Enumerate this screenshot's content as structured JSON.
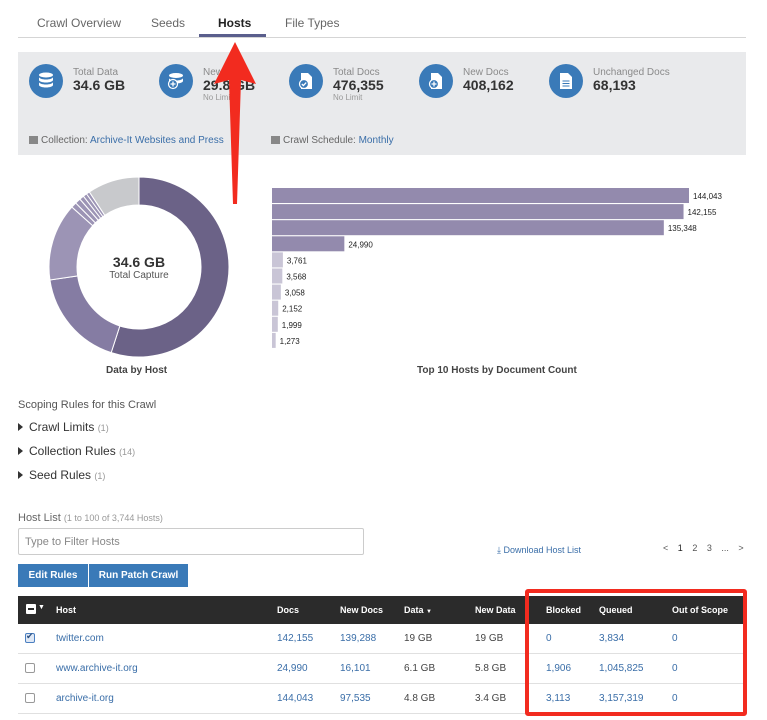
{
  "tabs": [
    "Crawl Overview",
    "Seeds",
    "Hosts",
    "File Types"
  ],
  "active_tab": "Hosts",
  "stats": {
    "total_data": {
      "label": "Total Data",
      "value": "34.6 GB"
    },
    "new_data": {
      "label": "New Data",
      "value": "29.8 GB",
      "sub": "No Limit"
    },
    "total_docs": {
      "label": "Total Docs",
      "value": "476,355",
      "sub": "No Limit"
    },
    "new_docs": {
      "label": "New Docs",
      "value": "408,162"
    },
    "unchanged_docs": {
      "label": "Unchanged Docs",
      "value": "68,193"
    }
  },
  "meta": {
    "collection_label": "Collection:",
    "collection_value": "Archive-It Websites and Press",
    "schedule_label": "Crawl Schedule:",
    "schedule_value": "Monthly"
  },
  "donut": {
    "value": "34.6 GB",
    "caption": "Total Capture",
    "title": "Data by Host",
    "colors": [
      "#6b6287",
      "#857ca3",
      "#9c94b5",
      "#c8c9cc"
    ],
    "slices": [
      0.55,
      0.177,
      0.139,
      0.01,
      0.01,
      0.008,
      0.007,
      0.006,
      0.093
    ]
  },
  "chart_data": {
    "type": "bar",
    "orientation": "horizontal",
    "title": "Top 10 Hosts by Document Count",
    "values": [
      144043,
      142155,
      135348,
      24990,
      3761,
      3568,
      3058,
      2152,
      1999,
      1273
    ],
    "labels": [
      "144,043",
      "142,155",
      "135,348",
      "24,990",
      "3,761",
      "3,568",
      "3,058",
      "2,152",
      "1,999",
      "1,273"
    ],
    "colors": {
      "bar": "#938aad",
      "bar_light": "#c9c5d6"
    }
  },
  "scoping": {
    "title": "Scoping Rules for this Crawl",
    "rules": [
      {
        "label": "Crawl Limits",
        "count": "(1)"
      },
      {
        "label": "Collection Rules",
        "count": "(14)"
      },
      {
        "label": "Seed Rules",
        "count": "(1)"
      }
    ]
  },
  "hostlist": {
    "title": "Host List",
    "subtitle": "(1 to 100 of 3,744 Hosts)",
    "filter_placeholder": "Type to Filter Hosts",
    "download": "Download Host List",
    "pages": [
      "1",
      "2",
      "3",
      "...",
      ">"
    ],
    "edit_rules": "Edit Rules",
    "run_patch": "Run Patch Crawl"
  },
  "table": {
    "headers": {
      "host": "Host",
      "docs": "Docs",
      "new_docs": "New Docs",
      "data": "Data",
      "new_data": "New Data",
      "blocked": "Blocked",
      "queued": "Queued",
      "out_of_scope": "Out of Scope"
    },
    "rows": [
      {
        "checked": true,
        "host": "twitter.com",
        "docs": "142,155",
        "new_docs": "139,288",
        "data": "19 GB",
        "new_data": "19 GB",
        "blocked": "0",
        "queued": "3,834",
        "out_of_scope": "0"
      },
      {
        "checked": false,
        "host": "www.archive-it.org",
        "docs": "24,990",
        "new_docs": "16,101",
        "data": "6.1 GB",
        "new_data": "5.8 GB",
        "blocked": "1,906",
        "queued": "1,045,825",
        "out_of_scope": "0"
      },
      {
        "checked": false,
        "host": "archive-it.org",
        "docs": "144,043",
        "new_docs": "97,535",
        "data": "4.8 GB",
        "new_data": "3.4 GB",
        "blocked": "3,113",
        "queued": "3,157,319",
        "out_of_scope": "0"
      }
    ]
  },
  "accent_color": "#3a7ab8",
  "annotation_color": "#f22b1f"
}
